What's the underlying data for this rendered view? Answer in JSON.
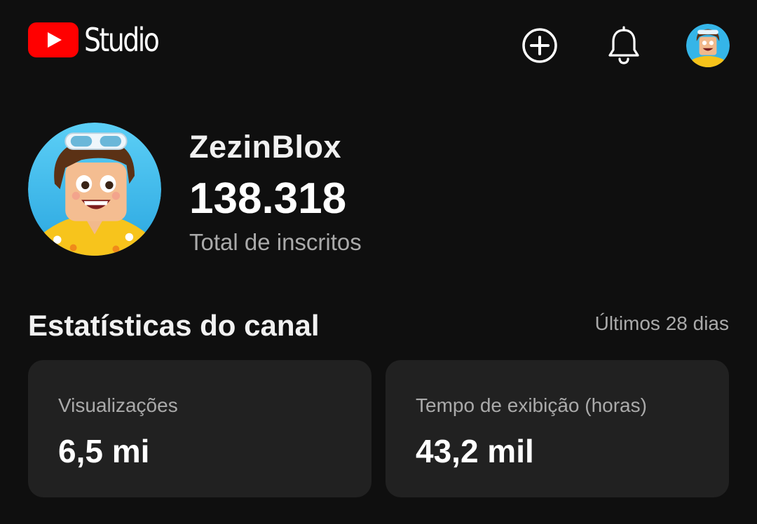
{
  "header": {
    "logo_text": "Studio",
    "icons": [
      "youtube-logo-icon",
      "create-icon",
      "bell-icon",
      "account-avatar"
    ]
  },
  "channel": {
    "name": "ZezinBlox",
    "subscribers": "138.318",
    "subscribers_label": "Total de inscritos"
  },
  "stats": {
    "title": "Estatísticas do canal",
    "period": "Últimos 28 dias",
    "cards": [
      {
        "label": "Visualizações",
        "value": "6,5 mi"
      },
      {
        "label": "Tempo de exibição (horas)",
        "value": "43,2 mil"
      }
    ]
  },
  "colors": {
    "background": "#0f0f0f",
    "card": "#212121",
    "brand_red": "#ff0000",
    "secondary_text": "#aaaaaa"
  }
}
